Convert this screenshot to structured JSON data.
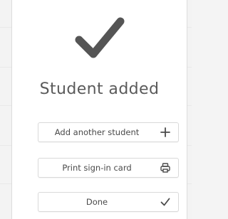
{
  "dialog": {
    "title": "Student added",
    "buttons": {
      "add_another": {
        "label": "Add another student",
        "icon": "plus-icon"
      },
      "print_card": {
        "label": "Print sign-in card",
        "icon": "printer-icon"
      },
      "done": {
        "label": "Done",
        "icon": "checkmark-icon"
      }
    },
    "status_icon": "large-checkmark-icon"
  },
  "colors": {
    "check": "#555555",
    "text": "#4a4a4a",
    "title": "#5a5a5a",
    "border": "#d9d9d9",
    "background": "#f3f3f3"
  }
}
